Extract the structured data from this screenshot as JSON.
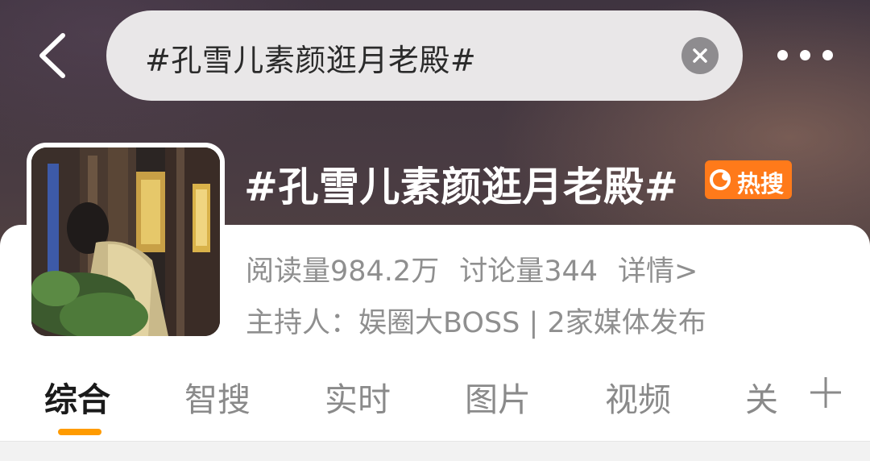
{
  "search": {
    "query": "#孔雪儿素颜逛月老殿#"
  },
  "topic": {
    "title": "#孔雪儿素颜逛月老殿#",
    "badge_label": "热搜",
    "reads": "阅读量984.2万",
    "discussions": "讨论量344",
    "details_link": "详情>",
    "host_line": "主持人：娱圈大BOSS | 2家媒体发布"
  },
  "tabs": [
    {
      "label": "综合",
      "active": true
    },
    {
      "label": "智搜",
      "active": false
    },
    {
      "label": "实时",
      "active": false
    },
    {
      "label": "图片",
      "active": false
    },
    {
      "label": "视频",
      "active": false
    },
    {
      "label": "关",
      "active": false
    }
  ],
  "icons": {
    "back": "chevron-left-icon",
    "clear": "close-icon",
    "more": "more-horizontal-icon",
    "hot": "flame-icon",
    "add_tab": "plus-icon"
  },
  "colors": {
    "accent": "#ff9b00",
    "hot_badge": "#ff7a1a"
  }
}
